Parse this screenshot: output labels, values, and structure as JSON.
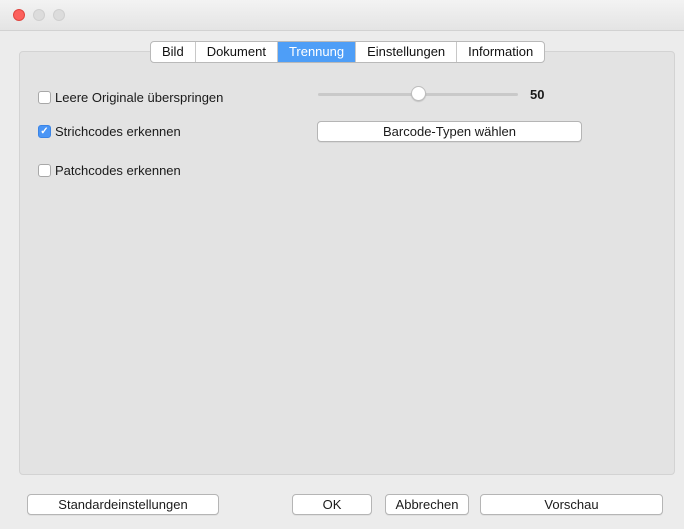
{
  "window": {
    "tabs": [
      {
        "label": "Bild",
        "active": false
      },
      {
        "label": "Dokument",
        "active": false
      },
      {
        "label": "Trennung",
        "active": true
      },
      {
        "label": "Einstellungen",
        "active": false
      },
      {
        "label": "Information",
        "active": false
      }
    ]
  },
  "options": {
    "skip_blank": {
      "label": "Leere Originale überspringen",
      "checked": false
    },
    "slider": {
      "value": "50",
      "position_fraction": 0.5
    },
    "barcodes": {
      "label": "Strichcodes erkennen",
      "checked": true,
      "button_label": "Barcode-Typen wählen"
    },
    "patchcodes": {
      "label": "Patchcodes erkennen",
      "checked": false
    }
  },
  "footer": {
    "defaults_label": "Standardeinstellungen",
    "ok_label": "OK",
    "cancel_label": "Abbrechen",
    "preview_label": "Vorschau"
  },
  "colors": {
    "accent": "#4e9ef7",
    "close_light": "#fc605c"
  }
}
